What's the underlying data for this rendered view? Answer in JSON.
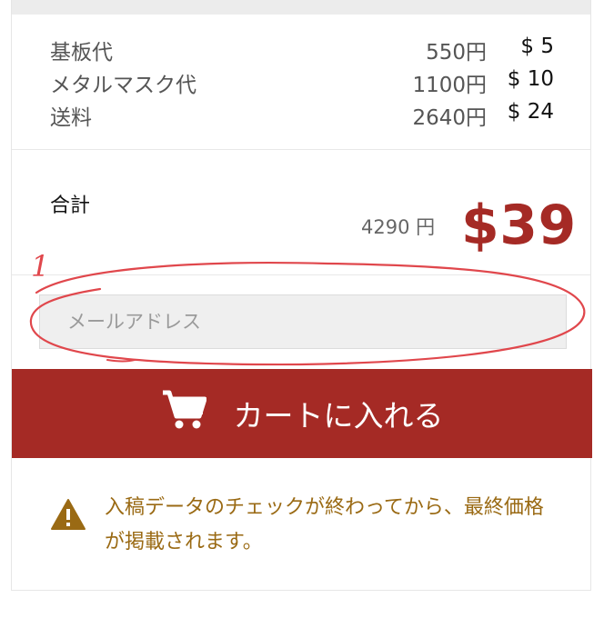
{
  "breakdown": [
    {
      "label": "基板代",
      "yen": "550円",
      "usd": "$ 5"
    },
    {
      "label": "メタルマスク代",
      "yen": "1100円",
      "usd": "$ 10"
    },
    {
      "label": "送料",
      "yen": "2640円",
      "usd": "$ 24"
    }
  ],
  "total": {
    "label": "合計",
    "yen": "4290 円",
    "usd": "$39"
  },
  "email": {
    "placeholder": "メールアドレス",
    "value": ""
  },
  "cart": {
    "label": "カートに入れる",
    "icon": "cart-icon"
  },
  "notice": {
    "icon": "warning-icon",
    "text": "入稿データのチェックが終わってから、最終価格が掲載されます。"
  },
  "annotation": {
    "number": "1",
    "color": "#e0474c"
  },
  "colors": {
    "accent": "#a52a25",
    "notice": "#9a6a14"
  }
}
